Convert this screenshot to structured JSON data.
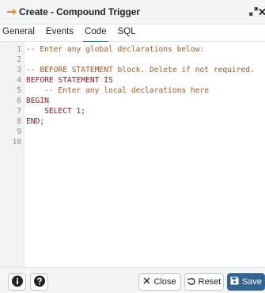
{
  "dialog": {
    "title": "Create - Compound Trigger"
  },
  "tabs": [
    {
      "label": "General"
    },
    {
      "label": "Events"
    },
    {
      "label": "Code"
    },
    {
      "label": "SQL"
    }
  ],
  "active_tab": "Code",
  "editor": {
    "lines": [
      {
        "num": "1",
        "text": "-- Enter any global declarations below:",
        "kind": "comment"
      },
      {
        "num": "2",
        "text": "",
        "kind": "text"
      },
      {
        "num": "3",
        "text": "-- BEFORE STATEMENT block. Delete if not required.",
        "kind": "comment"
      },
      {
        "num": "4",
        "text": "BEFORE STATEMENT IS",
        "kind": "keyword"
      },
      {
        "num": "5",
        "text": "    -- Enter any local declarations here",
        "kind": "comment"
      },
      {
        "num": "6",
        "text": "BEGIN",
        "kind": "keyword"
      },
      {
        "num": "7",
        "text": "    SELECT 1;",
        "kind": "keyword"
      },
      {
        "num": "8",
        "text": "END;",
        "kind": "keyword"
      },
      {
        "num": "9",
        "text": "",
        "kind": "text"
      },
      {
        "num": "10",
        "text": "",
        "kind": "text"
      }
    ]
  },
  "footer": {
    "close_label": "Close",
    "reset_label": "Reset",
    "save_label": "Save"
  },
  "colors": {
    "accent": "#326690",
    "arrow": "#e58b2b",
    "comment": "#a05a2c",
    "keyword": "#8b1a2b"
  },
  "icons": {
    "title": "arrow-right-icon",
    "maximize": "expand-icon",
    "close": "close-icon",
    "info": "info-icon",
    "help": "help-icon",
    "close_btn": "x-icon",
    "reset_btn": "reset-icon",
    "save_btn": "save-icon"
  }
}
